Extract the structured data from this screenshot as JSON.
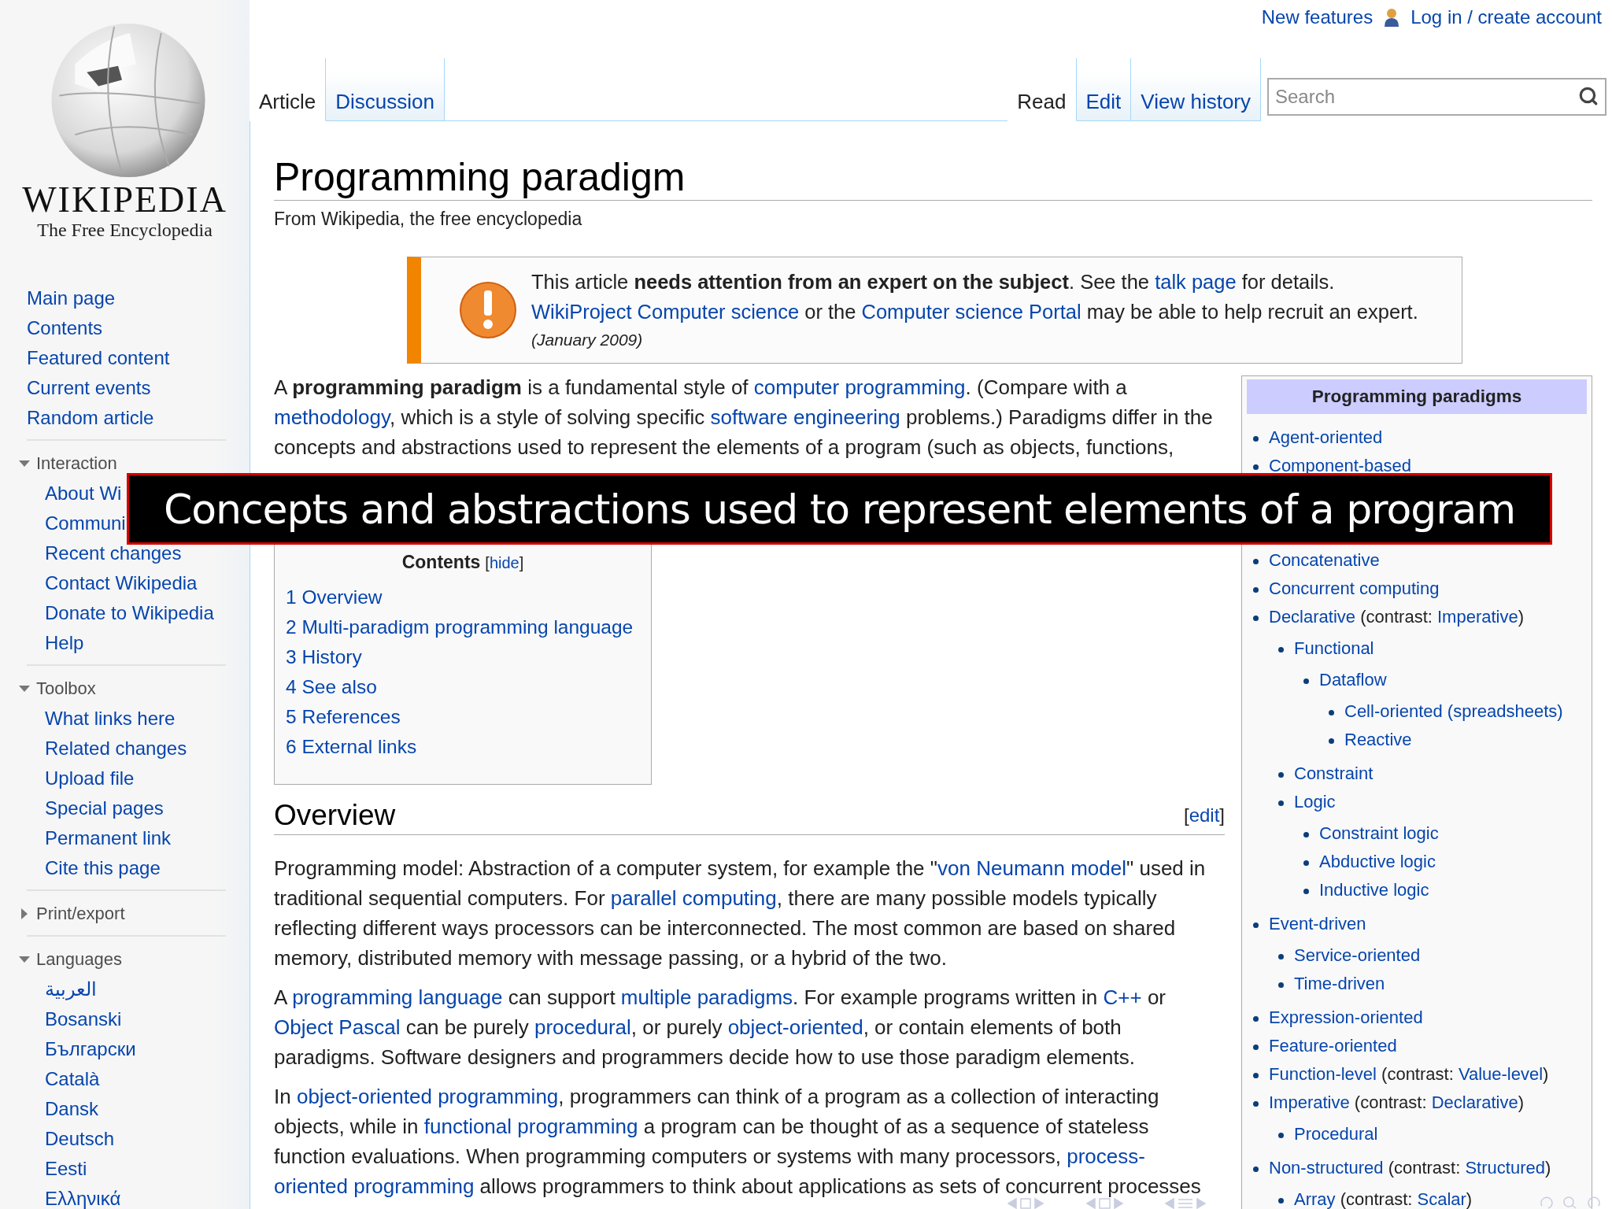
{
  "sidebar": {
    "logo": {
      "wordmark": "WIKIPEDIA",
      "tagline": "The Free Encyclopedia"
    },
    "navigation": [
      "Main page",
      "Contents",
      "Featured content",
      "Current events",
      "Random article"
    ],
    "sections": [
      {
        "title": "Interaction",
        "expanded": true,
        "items": [
          "About Wi",
          "Communi",
          "Recent changes",
          "Contact Wikipedia",
          "Donate to Wikipedia",
          "Help"
        ]
      },
      {
        "title": "Toolbox",
        "expanded": true,
        "items": [
          "What links here",
          "Related changes",
          "Upload file",
          "Special pages",
          "Permanent link",
          "Cite this page"
        ]
      },
      {
        "title": "Print/export",
        "expanded": false
      },
      {
        "title": "Languages",
        "expanded": true,
        "items": [
          "العربية",
          "Bosanski",
          "Български",
          "Català",
          "Dansk",
          "Deutsch",
          "Eesti",
          "Ελληνικά"
        ]
      }
    ]
  },
  "personal_links": [
    "New features",
    "Log in / create account"
  ],
  "page_tabs": [
    {
      "label": "Article",
      "selected": true
    },
    {
      "label": "Discussion",
      "selected": false
    }
  ],
  "view_tabs": [
    {
      "label": "Read",
      "selected": true
    },
    {
      "label": "Edit",
      "selected": false
    },
    {
      "label": "View history",
      "selected": false
    }
  ],
  "search": {
    "placeholder": "Search"
  },
  "article": {
    "title": "Programming paradigm",
    "subtitle": "From Wikipedia, the free encyclopedia",
    "notice": {
      "lines": [
        [
          {
            "kind": "text",
            "t": "This article **needs attention from an expert on the subject**. See the "
          },
          {
            "kind": "link",
            "t": "talk page"
          },
          {
            "kind": "text",
            "t": " for details."
          }
        ],
        [
          {
            "kind": "link",
            "t": "WikiProject Computer science"
          },
          {
            "kind": "text",
            "t": " or the "
          },
          {
            "kind": "link",
            "t": "Computer science Portal"
          },
          {
            "kind": "text",
            "t": " may be able to help recruit an expert."
          }
        ]
      ],
      "date": "(January 2009)"
    },
    "intro": [
      {
        "kind": "text",
        "t": "A **programming paradigm** is a fundamental style of "
      },
      {
        "kind": "link",
        "t": "computer programming"
      },
      {
        "kind": "text",
        "t": ". (Compare with a "
      },
      {
        "kind": "link",
        "t": "methodology"
      },
      {
        "kind": "text",
        "t": ", which is a style of solving specific "
      },
      {
        "kind": "link",
        "t": "software engineering"
      },
      {
        "kind": "text",
        "t": " problems.) Paradigms differ in the concepts and abstractions used to represent the elements of a program (such as objects, functions,"
      }
    ],
    "toc": {
      "title": "Contents",
      "toggle": [
        "[",
        "hide",
        "]"
      ],
      "items": [
        "1 Overview",
        "2 Multi-paradigm programming language",
        "3 History",
        "4 See also",
        "5 References",
        "6 External links"
      ]
    },
    "section": {
      "heading": "Overview",
      "edit": [
        "[",
        "edit",
        "]"
      ],
      "paragraphs": [
        [
          {
            "kind": "text",
            "t": "Programming model: Abstraction of a computer system, for example the \""
          },
          {
            "kind": "link",
            "t": "von Neumann model"
          },
          {
            "kind": "text",
            "t": "\" used in traditional sequential computers. For "
          },
          {
            "kind": "link",
            "t": "parallel computing"
          },
          {
            "kind": "text",
            "t": ", there are many possible models typically reflecting different ways processors can be interconnected. The most common are based on shared memory, distributed memory with message passing, or a hybrid of the two."
          }
        ],
        [
          {
            "kind": "text",
            "t": "A "
          },
          {
            "kind": "link",
            "t": "programming language"
          },
          {
            "kind": "text",
            "t": " can support "
          },
          {
            "kind": "link",
            "t": "multiple paradigms"
          },
          {
            "kind": "text",
            "t": ". For example programs written in "
          },
          {
            "kind": "link",
            "t": "C++"
          },
          {
            "kind": "text",
            "t": " or "
          },
          {
            "kind": "link",
            "t": "Object Pascal"
          },
          {
            "kind": "text",
            "t": " can be purely "
          },
          {
            "kind": "link",
            "t": "procedural"
          },
          {
            "kind": "text",
            "t": ", or purely "
          },
          {
            "kind": "link",
            "t": "object-oriented"
          },
          {
            "kind": "text",
            "t": ", or contain elements of both paradigms. Software designers and programmers decide how to use those paradigm elements."
          }
        ],
        [
          {
            "kind": "text",
            "t": "In "
          },
          {
            "kind": "link",
            "t": "object-oriented programming"
          },
          {
            "kind": "text",
            "t": ", programmers can think of a program as a collection of interacting objects, while in "
          },
          {
            "kind": "link",
            "t": "functional programming"
          },
          {
            "kind": "text",
            "t": " a program can be thought of as a sequence of stateless function evaluations. When programming computers or systems with many processors, "
          },
          {
            "kind": "link",
            "t": "process-"
          },
          {
            "kind": "link",
            "t": "oriented programming"
          },
          {
            "kind": "text",
            "t": " allows programmers to think about applications as sets of concurrent processes"
          }
        ]
      ]
    }
  },
  "infobox": {
    "title": "Programming paradigms",
    "items": [
      {
        "label": "Agent-oriented"
      },
      {
        "label": "Component-based"
      },
      {
        "label": "Concatenative"
      },
      {
        "label": "Concurrent computing"
      },
      {
        "label": "Declarative",
        "note": [
          {
            "kind": "text",
            "t": " (contrast: "
          },
          {
            "kind": "link",
            "t": "Imperative"
          },
          {
            "kind": "text",
            "t": ")"
          }
        ],
        "children": [
          {
            "label": "Functional",
            "children": [
              {
                "label": "Dataflow",
                "children": [
                  {
                    "label": "Cell-oriented (spreadsheets)"
                  },
                  {
                    "label": "Reactive"
                  }
                ]
              }
            ]
          },
          {
            "label": "Constraint"
          },
          {
            "label": "Logic",
            "children": [
              {
                "label": "Constraint logic"
              },
              {
                "label": "Abductive logic"
              },
              {
                "label": "Inductive logic"
              }
            ]
          }
        ]
      },
      {
        "label": "Event-driven",
        "children": [
          {
            "label": "Service-oriented"
          },
          {
            "label": "Time-driven"
          }
        ]
      },
      {
        "label": "Expression-oriented"
      },
      {
        "label": "Feature-oriented"
      },
      {
        "label": "Function-level",
        "note": [
          {
            "kind": "text",
            "t": " (contrast: "
          },
          {
            "kind": "link",
            "t": "Value-level"
          },
          {
            "kind": "text",
            "t": ")"
          }
        ]
      },
      {
        "label": "Imperative",
        "note": [
          {
            "kind": "text",
            "t": " (contrast: "
          },
          {
            "kind": "link",
            "t": "Declarative"
          },
          {
            "kind": "text",
            "t": ")"
          }
        ],
        "children": [
          {
            "label": "Procedural"
          }
        ]
      },
      {
        "label": "Non-structured",
        "note": [
          {
            "kind": "text",
            "t": " (contrast: "
          },
          {
            "kind": "link",
            "t": "Structured"
          },
          {
            "kind": "text",
            "t": ")"
          }
        ],
        "children": [
          {
            "label": "Array",
            "note": [
              {
                "kind": "text",
                "t": " (contrast: "
              },
              {
                "kind": "link",
                "t": "Scalar"
              },
              {
                "kind": "text",
                "t": ")"
              }
            ]
          }
        ]
      }
    ]
  },
  "caption": "Concepts and abstractions used to represent elements of a program"
}
